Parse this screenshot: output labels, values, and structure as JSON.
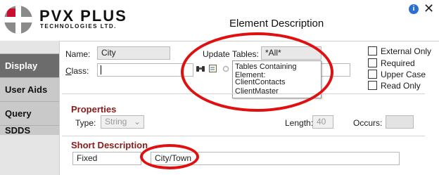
{
  "window": {
    "title": "Element Description",
    "info_symbol": "i",
    "close_symbol": "✕"
  },
  "logo": {
    "name": "PVX PLUS",
    "subtitle": "TECHNOLOGIES LTD."
  },
  "sidebar": {
    "tabs": [
      {
        "label": "Display",
        "active": true
      },
      {
        "label": "User Aids",
        "active": false
      },
      {
        "label": "Query",
        "active": false
      },
      {
        "label": "SDDS",
        "active": false
      }
    ]
  },
  "form": {
    "name_label": "Name:",
    "name_value": "City",
    "update_tables_label": "Update Tables:",
    "update_tables_value": "*All*",
    "class_label": "Class:",
    "class_value": "",
    "checkboxes": [
      {
        "label": "External Only",
        "checked": false
      },
      {
        "label": "Required",
        "checked": false
      },
      {
        "label": "Upper Case",
        "checked": false
      },
      {
        "label": "Read Only",
        "checked": false
      }
    ]
  },
  "tooltip": {
    "title": "Tables Containing Element:",
    "items": [
      "ClientContacts",
      "ClientMaster"
    ]
  },
  "properties": {
    "heading": "Properties",
    "type_label": "Type:",
    "type_value": "String",
    "length_label": "Length:",
    "length_value": "40",
    "occurs_label": "Occurs:",
    "occurs_value": ""
  },
  "short_description": {
    "heading": "Short Description",
    "mode_value": "Fixed",
    "text_value": "City/Town"
  },
  "colors": {
    "accent_red": "#8b1a1a",
    "annotation_red": "#e01010",
    "active_tab": "#6c6c6c"
  }
}
